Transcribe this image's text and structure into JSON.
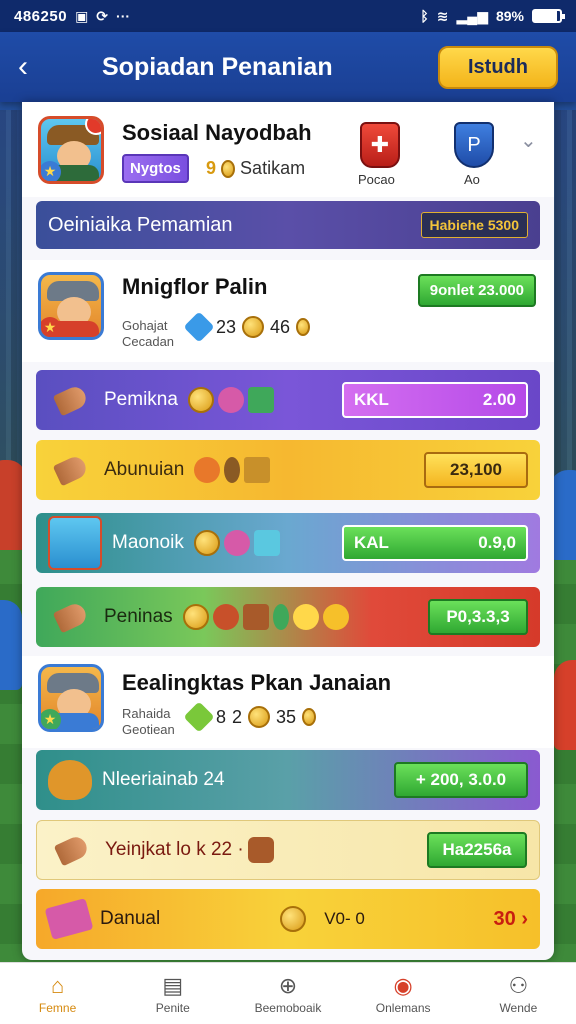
{
  "status_bar": {
    "time": "486250",
    "battery": "89%",
    "battery_level": 0.89
  },
  "app_bar": {
    "title": "Sopiadan Penanian",
    "action_label": "Istudh"
  },
  "profile": {
    "name": "Sosiaal Nayodbah",
    "tag": "Nygtos",
    "level_prefix": "9",
    "level_text": "Satikam",
    "badge_red_label": "Pocao",
    "badge_blue_label": "Ao"
  },
  "section_header": {
    "title": "Oeiniaika Pemamian",
    "pill": "Habiehe 5300"
  },
  "player_row_1": {
    "name": "Mnigflor Palin",
    "sub1": "Gohajat",
    "sub2": "Cecadan",
    "stat1": "23",
    "stat2": "46",
    "pill": "9onlet 23.000"
  },
  "bands": [
    {
      "label": "Pemikna",
      "value_left": "KKL",
      "value_right": "2.00"
    },
    {
      "label": "Abunuian",
      "value": "23,100"
    },
    {
      "label": "Maonoik",
      "value_left": "KAL",
      "value_right": "0.9,0"
    },
    {
      "label": "Peninas",
      "value": "P0,3.3,3"
    }
  ],
  "player_row_2": {
    "name": "Eealingktas Pkan Janaian",
    "sub1": "Rahaida",
    "sub2": "Geotiean",
    "stat1": "8",
    "stat2": "2",
    "stat3": "35"
  },
  "bands2": [
    {
      "label": "Nleeriainab 24",
      "value": "+ 200, 3.0.0"
    },
    {
      "label": "Yeinjkat lo k 22 ·",
      "value": "Ha2256a"
    },
    {
      "label": "Danual",
      "value": "V0- 0",
      "total": "30"
    }
  ],
  "bottom_nav": [
    {
      "label": "Femne",
      "icon": "home-icon"
    },
    {
      "label": "Penite",
      "icon": "document-icon"
    },
    {
      "label": "Beemoboaik",
      "icon": "plus-circle-icon"
    },
    {
      "label": "Onlemans",
      "icon": "map-pin-icon"
    },
    {
      "label": "Wende",
      "icon": "user-icon"
    }
  ],
  "colors": {
    "app_bar": "#1f4ca8",
    "accent_yellow": "#f3b41a",
    "nav_active": "#d68a10"
  }
}
